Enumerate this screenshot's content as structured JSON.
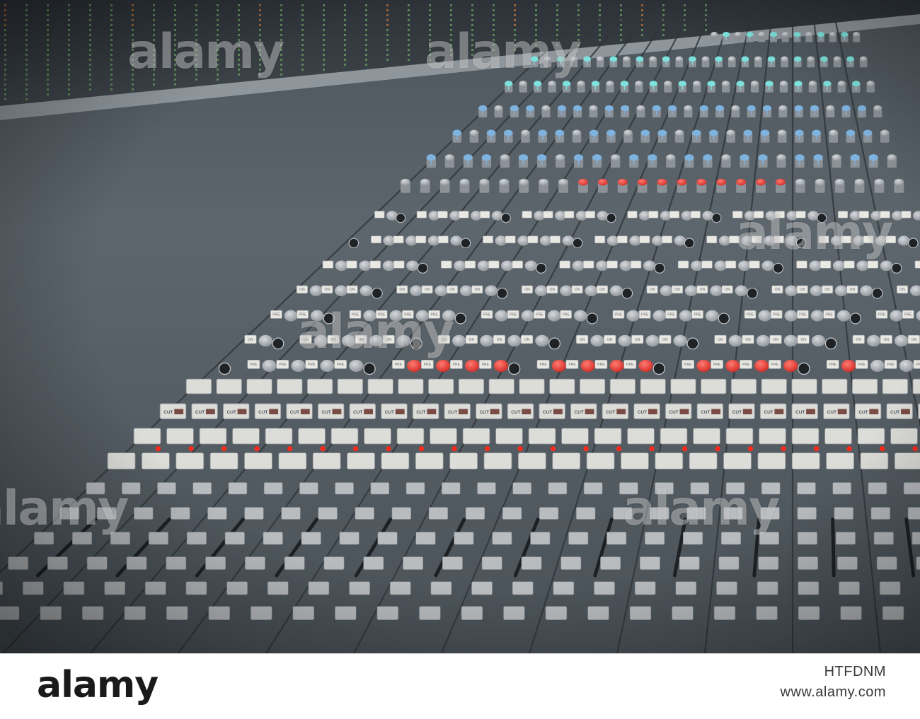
{
  "scene": {
    "description_name": "mixing-console-photo",
    "palette": {
      "panel": "#5b656d",
      "knob_grey": "#a6abb1",
      "knob_blue": "#7fb3df",
      "knob_cyan": "#7de2dd",
      "knob_red": "#e5453f",
      "button_white": "#e9e8e3",
      "led_red": "#ff2a1a",
      "meter_green": "#7bc46a",
      "meter_orange": "#ee8a34"
    }
  },
  "brand": {
    "logo": "alamy",
    "image_id": "HTFDNM",
    "url": "www.alamy.com"
  },
  "watermarks": [
    "alamy",
    "alamy",
    "alamy",
    "alamy",
    "alamy",
    "alamy",
    "alamy"
  ],
  "button_labels": {
    "cut": "CUT",
    "on": "ON",
    "pre": "PRE"
  }
}
